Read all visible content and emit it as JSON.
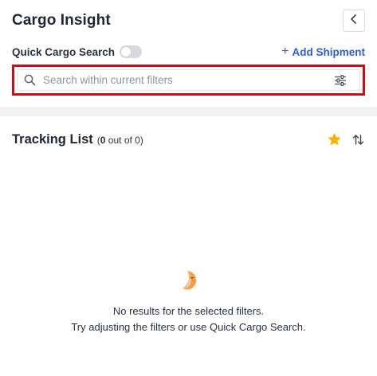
{
  "header": {
    "title": "Cargo Insight"
  },
  "quick_search": {
    "label": "Quick Cargo Search",
    "enabled": false,
    "add_shipment_label": "Add Shipment"
  },
  "search": {
    "placeholder": "Search within current filters",
    "value": ""
  },
  "tracking": {
    "title": "Tracking List",
    "count_prefix": "(",
    "count_shown": "0",
    "count_middle": " out of ",
    "count_total": "0",
    "count_suffix": ")"
  },
  "empty_state": {
    "line1": "No results for the selected filters.",
    "line2": "Try adjusting the filters or use Quick Cargo Search."
  },
  "colors": {
    "accent_blue": "#2f5bd3",
    "star": "#f5b400",
    "highlight_outline": "#e3000f",
    "moon": "#f2a247"
  },
  "icons": [
    "chevron-left-icon",
    "search-icon",
    "sliders-icon",
    "star-icon",
    "sort-icon",
    "moon-icon"
  ]
}
